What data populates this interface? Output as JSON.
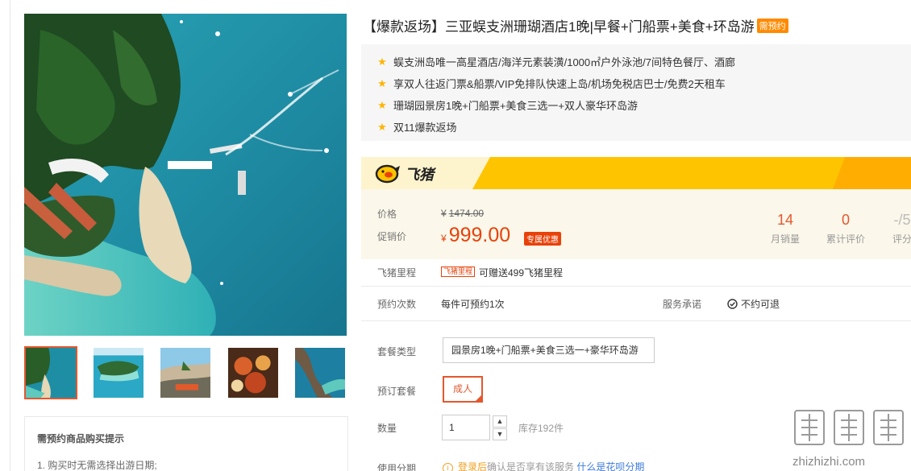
{
  "product": {
    "title": "【爆款返场】三亚蜈支洲珊瑚酒店1晚|早餐+门船票+美食+环岛游",
    "title_tag": "需预约",
    "highlights": [
      "蜈支洲岛唯一高星酒店/海洋元素装潢/1000㎡户外泳池/7间特色餐厅、酒廊",
      "享双人往返门票&船票/VIP免排队快速上岛/机场免税店巴士/免费2天租车",
      "珊瑚园景房1晚+门船票+美食三选一+双人豪华环岛游",
      "双11爆款返场"
    ]
  },
  "brand": {
    "name": "飞猪",
    "accent": "#ffc400"
  },
  "price": {
    "label": "价格",
    "currency": "¥",
    "original": "1474.00",
    "promo_label": "促销价",
    "promo": "999.00",
    "promo_tag": "专属优惠"
  },
  "stats": [
    {
      "num": "14",
      "label": "月销量"
    },
    {
      "num": "0",
      "label": "累计评价"
    },
    {
      "num": "-/5",
      "label": "评分"
    }
  ],
  "mileage": {
    "label": "飞猪里程",
    "tag": "飞猪里程",
    "text": "可赠送499飞猪里程"
  },
  "booking": {
    "limit_label": "预约次数",
    "limit_value": "每件可预约1次",
    "service_label": "服务承诺",
    "service_value": "不约可退"
  },
  "options": {
    "package_type_label": "套餐类型",
    "package_type_value": "园景房1晚+门船票+美食三选一+豪华环岛游",
    "package_label": "预订套餐",
    "package_value": "成人",
    "qty_label": "数量",
    "qty_value": "1",
    "stock": "库存192件",
    "installment_label": "使用分期",
    "installment_note_orange": "登录后",
    "installment_note": "确认是否享有该服务",
    "installment_link": "什么是花呗分期"
  },
  "tips": {
    "title": "需预约商品购买提示",
    "lines": [
      "1. 购买时无需选择出游日期;"
    ]
  },
  "watermark_text": "值值值 zhizhizhi.com",
  "icons": {
    "star": "star-icon",
    "check": "check-circle-icon",
    "info": "info-icon",
    "up": "chevron-up-icon",
    "down": "chevron-down-icon"
  }
}
